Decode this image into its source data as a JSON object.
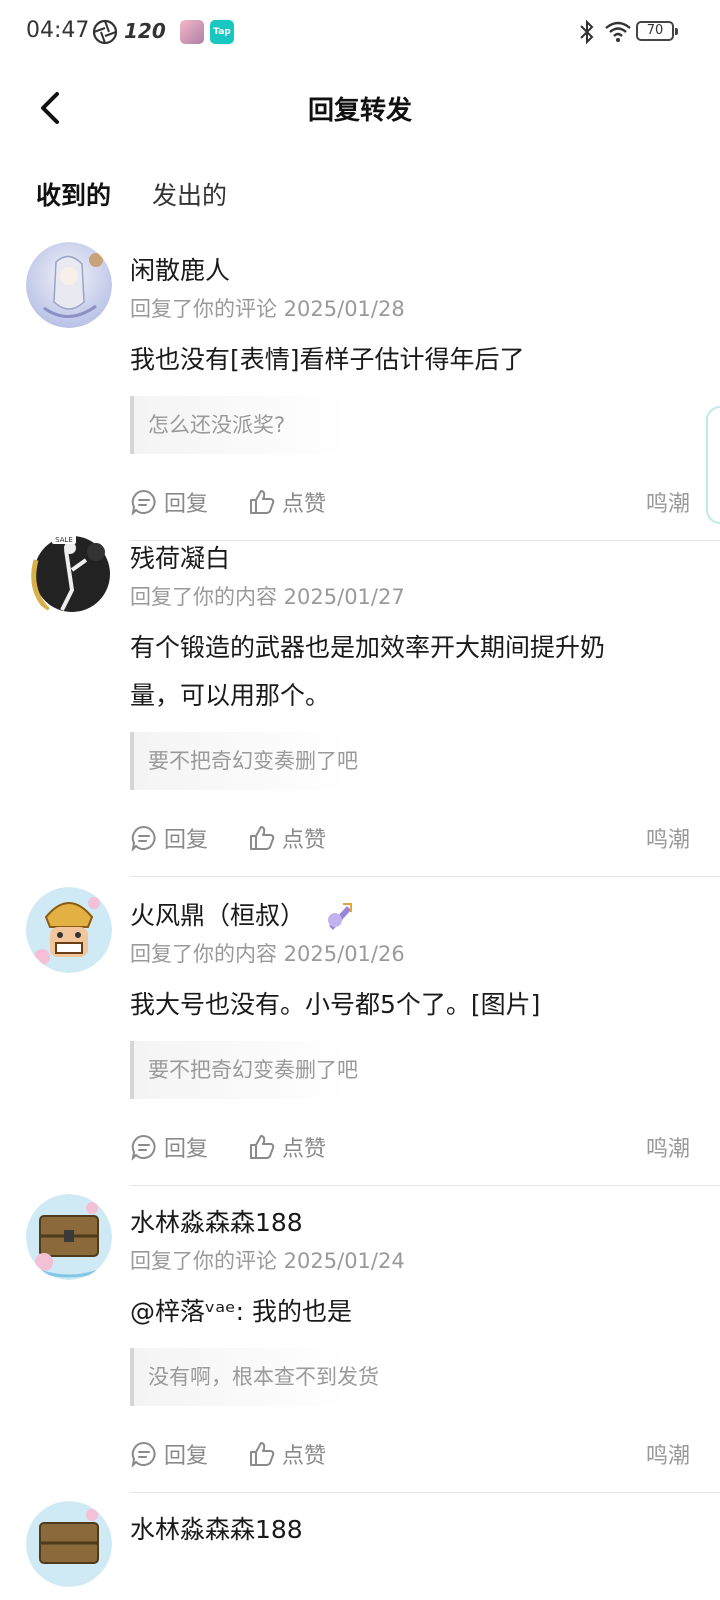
{
  "status_bar": {
    "time": "04:47",
    "refresh_rate": "120",
    "tap_label": "Tap",
    "battery": "70"
  },
  "header": {
    "title": "回复转发"
  },
  "tabs": [
    {
      "label": "收到的",
      "active": true
    },
    {
      "label": "发出的",
      "active": false
    }
  ],
  "actions": {
    "reply_label": "回复",
    "like_label": "点赞"
  },
  "items": [
    {
      "username": "闲散鹿人",
      "meta": "回复了你的评论 2025/01/28",
      "text": "我也没有[表情]看样子估计得年后了",
      "quote": "怎么还没派奖?",
      "source": "鸣潮"
    },
    {
      "username": "残荷凝白",
      "meta": "回复了你的内容 2025/01/27",
      "text": "有个锻造的武器也是加效率开大期间提升奶量，可以用那个。",
      "quote": "要不把奇幻变奏删了吧",
      "source": "鸣潮"
    },
    {
      "username": "火风鼎（桓叔）",
      "meta": "回复了你的内容 2025/01/26",
      "text": "我大号也没有。小号都5个了。[图片]",
      "quote": "要不把奇幻变奏删了吧",
      "source": "鸣潮"
    },
    {
      "username": "水林淼森森188",
      "meta": "回复了你的评论 2025/01/24",
      "text": "@梓落ᵛᵃᵉ: 我的也是",
      "quote": "没有啊，根本查不到发货",
      "source": "鸣潮"
    },
    {
      "username": "水林淼森森188"
    }
  ]
}
